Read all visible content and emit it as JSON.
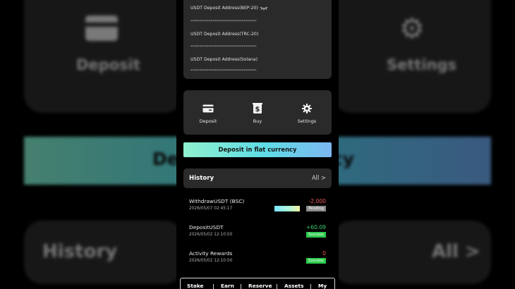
{
  "background": {
    "deposit_label": "Deposit",
    "settings_label": "Settings",
    "banner_left": "Depo",
    "banner_right": "ncy",
    "history_label": "History",
    "all_label": "All >"
  },
  "addresses": [
    {
      "label": "USDT Deposit Address(BEP-20)",
      "value": "************************************"
    },
    {
      "label": "USDT Deposit Address(TRC-20)",
      "value": "************************************"
    },
    {
      "label": "USDT Deposit Address(Solana)",
      "value": "************************************"
    }
  ],
  "actions": {
    "deposit": "Deposit",
    "buy": "Buy",
    "settings": "Settings"
  },
  "flat_button": "Deposit in flat currency",
  "history": {
    "title": "History",
    "all": "All >",
    "transactions": [
      {
        "name": "WithdrawUSDT (BSC)",
        "date": "2026/05/07 02:45:17",
        "amount": "-2,000",
        "status": "Pending",
        "cancel": "Cancel"
      },
      {
        "name": "DepositUSDT",
        "date": "2026/05/02 12:10:50",
        "amount": "+60.09",
        "status": "Success"
      },
      {
        "name": "Activity Rewards",
        "date": "2026/05/02 12:10:50",
        "amount": "0",
        "status": "Success"
      }
    ]
  },
  "tabs": [
    "Stake",
    "Earn",
    "Reserve",
    "Assets",
    "My"
  ],
  "colors": {
    "accent_gradient_start": "#8ff0cf",
    "accent_gradient_end": "#7cb7f0",
    "negative": "#f05a5a",
    "positive": "#3bd16f",
    "success_badge": "#2ecc4f",
    "pending_badge": "#8d8d8d"
  }
}
